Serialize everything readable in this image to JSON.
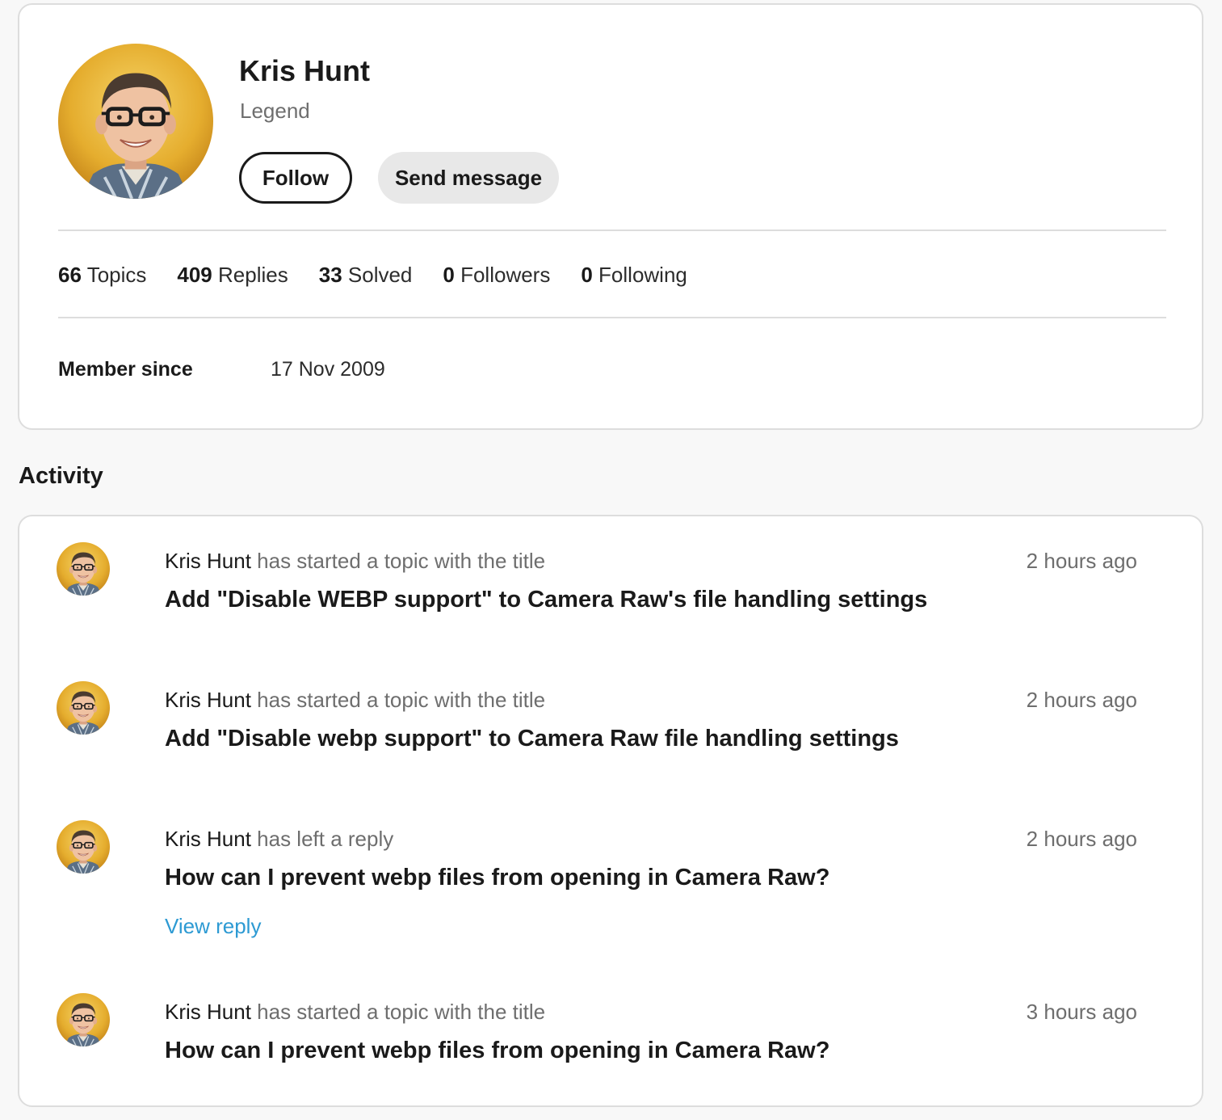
{
  "profile": {
    "name": "Kris Hunt",
    "rank": "Legend",
    "follow_label": "Follow",
    "message_label": "Send message",
    "avatar_icon": "user-avatar-photo",
    "stats": [
      {
        "value": "66",
        "label": "Topics"
      },
      {
        "value": "409",
        "label": "Replies"
      },
      {
        "value": "33",
        "label": "Solved"
      },
      {
        "value": "0",
        "label": "Followers"
      },
      {
        "value": "0",
        "label": "Following"
      }
    ],
    "member_since_label": "Member since",
    "member_since_value": "17 Nov 2009"
  },
  "activity": {
    "heading": "Activity",
    "items": [
      {
        "user": "Kris Hunt",
        "action": "has started a topic with the title",
        "title": "Add \"Disable WEBP support\" to Camera Raw's file handling settings",
        "time": "2 hours ago",
        "link": ""
      },
      {
        "user": "Kris Hunt",
        "action": "has started a topic with the title",
        "title": "Add \"Disable webp support\" to Camera Raw file handling settings",
        "time": "2 hours ago",
        "link": ""
      },
      {
        "user": "Kris Hunt",
        "action": "has left a reply",
        "title": "How can I prevent webp files from opening in Camera Raw?",
        "time": "2 hours ago",
        "link": "View reply"
      },
      {
        "user": "Kris Hunt",
        "action": "has started a topic with the title",
        "title": "How can I prevent webp files from opening in Camera Raw?",
        "time": "3 hours ago",
        "link": ""
      }
    ]
  },
  "colors": {
    "page_background": "#f8f8f8",
    "card_background": "#ffffff",
    "border": "#dddddd",
    "text_primary": "#1a1a1a",
    "text_secondary": "#6e6e6e",
    "link": "#2d9ad3",
    "avatar_background": "#e2a72a"
  }
}
